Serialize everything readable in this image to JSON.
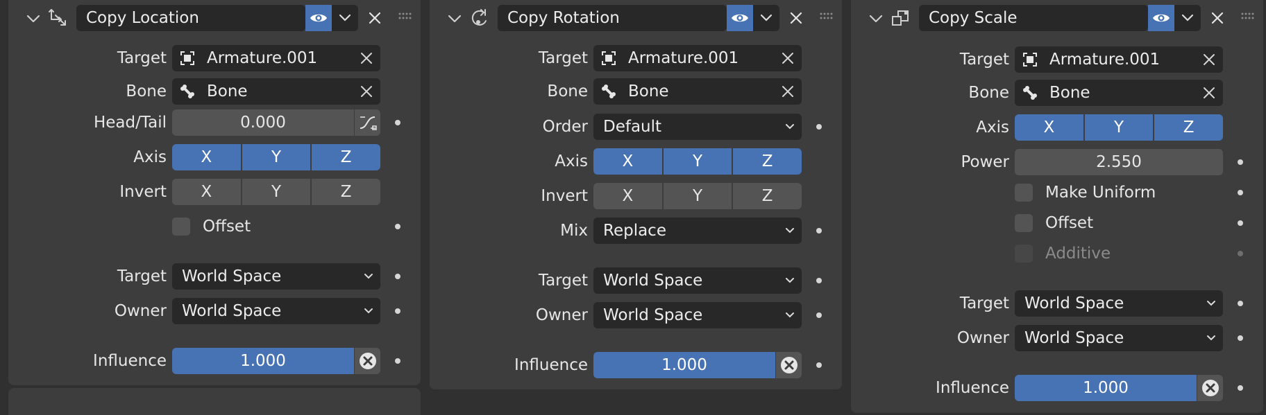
{
  "colors": {
    "accent": "#4772b3",
    "panel": "#3d3d3d",
    "background": "#303030",
    "field": "#282828",
    "button": "#545454"
  },
  "panels": [
    {
      "name": "Copy Location",
      "header_icon": "copy-location-icon",
      "target": {
        "label": "Target",
        "value": "Armature.001"
      },
      "bone": {
        "label": "Bone",
        "value": "Bone"
      },
      "head_tail": {
        "label": "Head/Tail",
        "value": "0.000"
      },
      "axis": {
        "label": "Axis",
        "x": "X",
        "y": "Y",
        "z": "Z",
        "enabled": [
          true,
          true,
          true
        ]
      },
      "invert": {
        "label": "Invert",
        "x": "X",
        "y": "Y",
        "z": "Z",
        "enabled": [
          false,
          false,
          false
        ]
      },
      "offset": {
        "label": "Offset",
        "checked": false
      },
      "target_space": {
        "label": "Target",
        "value": "World Space"
      },
      "owner_space": {
        "label": "Owner",
        "value": "World Space"
      },
      "influence": {
        "label": "Influence",
        "value": "1.000"
      }
    },
    {
      "name": "Copy Rotation",
      "header_icon": "copy-rotation-icon",
      "target": {
        "label": "Target",
        "value": "Armature.001"
      },
      "bone": {
        "label": "Bone",
        "value": "Bone"
      },
      "order": {
        "label": "Order",
        "value": "Default"
      },
      "axis": {
        "label": "Axis",
        "x": "X",
        "y": "Y",
        "z": "Z",
        "enabled": [
          true,
          true,
          true
        ]
      },
      "invert": {
        "label": "Invert",
        "x": "X",
        "y": "Y",
        "z": "Z",
        "enabled": [
          false,
          false,
          false
        ]
      },
      "mix": {
        "label": "Mix",
        "value": "Replace"
      },
      "target_space": {
        "label": "Target",
        "value": "World Space"
      },
      "owner_space": {
        "label": "Owner",
        "value": "World Space"
      },
      "influence": {
        "label": "Influence",
        "value": "1.000"
      }
    },
    {
      "name": "Copy Scale",
      "header_icon": "copy-scale-icon",
      "target": {
        "label": "Target",
        "value": "Armature.001"
      },
      "bone": {
        "label": "Bone",
        "value": "Bone"
      },
      "axis": {
        "label": "Axis",
        "x": "X",
        "y": "Y",
        "z": "Z",
        "enabled": [
          true,
          true,
          true
        ]
      },
      "power": {
        "label": "Power",
        "value": "2.550"
      },
      "make_uniform": {
        "label": "Make Uniform",
        "checked": false
      },
      "offset": {
        "label": "Offset",
        "checked": false
      },
      "additive": {
        "label": "Additive",
        "checked": false,
        "disabled": true
      },
      "target_space": {
        "label": "Target",
        "value": "World Space"
      },
      "owner_space": {
        "label": "Owner",
        "value": "World Space"
      },
      "influence": {
        "label": "Influence",
        "value": "1.000"
      }
    }
  ]
}
